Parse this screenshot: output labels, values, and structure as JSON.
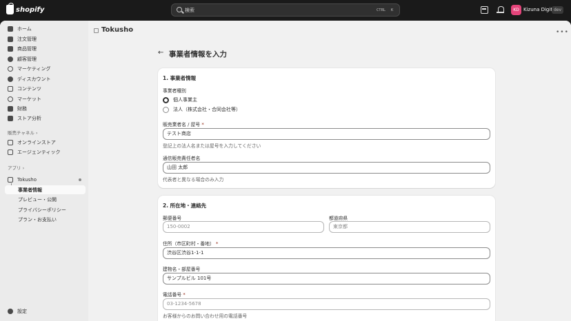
{
  "topbar": {
    "brand": "shopify",
    "search_placeholder": "検索",
    "shortcut_ctrl": "CTRL",
    "shortcut_k": "K",
    "avatar_initials": "KD",
    "store_name": "Kizuna Digital",
    "env_badge": "dev"
  },
  "sidebar": {
    "items": [
      {
        "label": "ホーム",
        "icon": "home-icon"
      },
      {
        "label": "注文管理",
        "icon": "orders-icon"
      },
      {
        "label": "商品管理",
        "icon": "tag-icon"
      },
      {
        "label": "顧客管理",
        "icon": "person-icon"
      },
      {
        "label": "マーケティング",
        "icon": "target-icon"
      },
      {
        "label": "ディスカウント",
        "icon": "discount-icon"
      },
      {
        "label": "コンテンツ",
        "icon": "content-icon"
      },
      {
        "label": "マーケット",
        "icon": "globe-icon"
      },
      {
        "label": "財務",
        "icon": "bank-icon"
      },
      {
        "label": "ストア分析",
        "icon": "analytics-icon"
      }
    ],
    "sales_channels_label": "販売チャネル",
    "channels": [
      {
        "label": "オンラインストア",
        "icon": "store-icon"
      },
      {
        "label": "エージェンティック",
        "icon": "agent-icon"
      }
    ],
    "apps_label": "アプリ",
    "app_name": "Tokusho",
    "app_subitems": [
      "事業者情報",
      "プレビュー・公開",
      "プライバシーポリシー",
      "プラン・お支払い"
    ],
    "settings_label": "設定"
  },
  "header": {
    "app_title": "Tokusho"
  },
  "page": {
    "title": "事業者情報を入力",
    "section1": {
      "title": "1. 事業者情報",
      "type_label": "事業者種別",
      "radio_individual": "個人事業主",
      "radio_corporate": "法人（株式会社・合同会社等）",
      "selected": "個人事業主",
      "seller_name_label": "販売業者名 / 屋号",
      "seller_name_value": "テスト商店",
      "seller_name_help": "登記上の法人名または屋号を入力してください",
      "manager_label": "通信販売責任者名",
      "manager_value": "山田 太郎",
      "manager_help": "代表者と異なる場合のみ入力"
    },
    "section2": {
      "title": "2. 所在地・連絡先",
      "postal_label": "郵便番号",
      "postal_placeholder": "150-0002",
      "prefecture_label": "都道府県",
      "prefecture_placeholder": "東京都",
      "address_label": "住所（市区町村・番地）",
      "address_value": "渋谷区渋谷1-1-1",
      "building_label": "建物名・部屋番号",
      "building_value": "サンプルビル 101号",
      "phone_label": "電話番号",
      "phone_placeholder": "03-1234-5678",
      "phone_help": "お客様からのお問い合わせ用の電話番号"
    },
    "required_mark": "*"
  },
  "colors": {
    "topbar_bg": "#1a1a1a",
    "avatar_bg": "#e4447a",
    "required": "#8e1f0b"
  }
}
